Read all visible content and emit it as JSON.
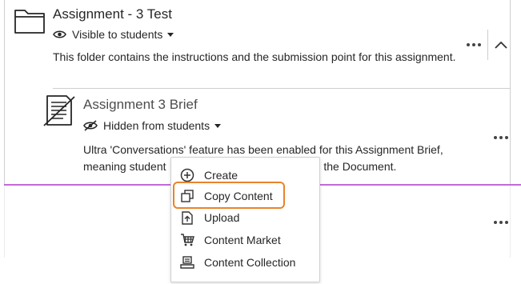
{
  "folder": {
    "title": "Assignment - 3 Test",
    "visibility": "Visible to students",
    "description": "This folder contains the instructions and the submission point for this assignment."
  },
  "document": {
    "title": "Assignment 3 Brief",
    "visibility": "Hidden from students",
    "description": "Ultra 'Conversations' feature has been enabled for this Assignment Brief, meaning student                                    s next to the Document."
  },
  "menu": {
    "items": [
      {
        "label": "Create",
        "icon": "plus-circle-icon"
      },
      {
        "label": "Copy Content",
        "icon": "copy-icon"
      },
      {
        "label": "Upload",
        "icon": "upload-icon"
      },
      {
        "label": "Content Market",
        "icon": "cart-icon"
      },
      {
        "label": "Content Collection",
        "icon": "collection-icon"
      }
    ]
  },
  "colors": {
    "divider_purple": "#c36ad8",
    "highlight_orange": "#e8842b",
    "border": "#cfcfcf"
  }
}
